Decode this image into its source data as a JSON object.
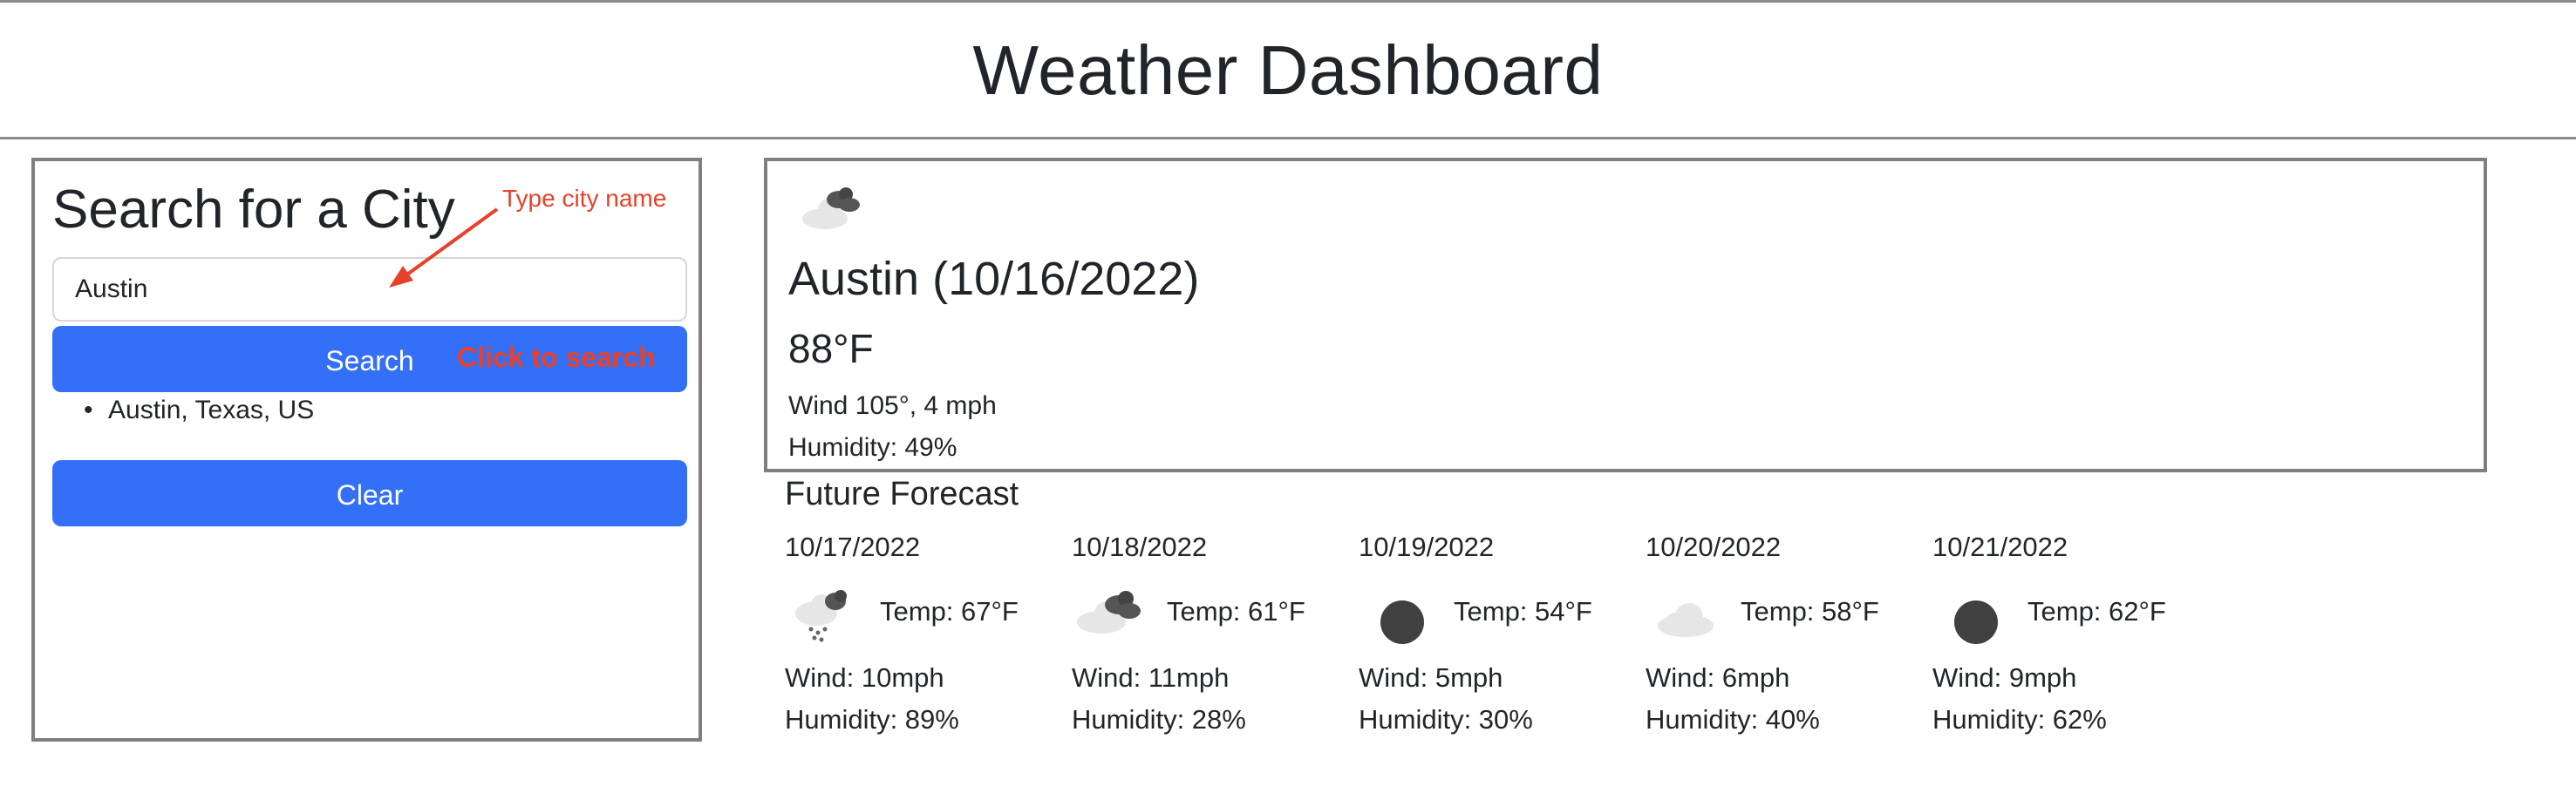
{
  "header": {
    "title": "Weather Dashboard"
  },
  "search": {
    "title": "Search for a City",
    "input_value": "Austin",
    "search_button_label": "Search",
    "clear_button_label": "Clear",
    "history": [
      "Austin, Texas, US"
    ],
    "accent_color": "#3370f7"
  },
  "annotations": {
    "type_hint": "Type city name",
    "click_hint": "Click to search",
    "color": "#e8412a"
  },
  "current": {
    "icon": "broken-clouds-icon",
    "city": "Austin (10/16/2022)",
    "temp": "88°F",
    "wind": "Wind 105°, 4 mph",
    "humidity": "Humidity: 49%"
  },
  "forecast": {
    "title": "Future Forecast",
    "days": [
      {
        "date": "10/17/2022",
        "icon": "rain-cloud-icon",
        "temp": "Temp: 67°F",
        "wind": "Wind: 10mph",
        "humidity": "Humidity: 89%"
      },
      {
        "date": "10/18/2022",
        "icon": "broken-clouds-icon",
        "temp": "Temp: 61°F",
        "wind": "Wind: 11mph",
        "humidity": "Humidity: 28%"
      },
      {
        "date": "10/19/2022",
        "icon": "overcast-circle-icon",
        "temp": "Temp: 54°F",
        "wind": "Wind: 5mph",
        "humidity": "Humidity: 30%"
      },
      {
        "date": "10/20/2022",
        "icon": "cloud-icon",
        "temp": "Temp: 58°F",
        "wind": "Wind: 6mph",
        "humidity": "Humidity: 40%"
      },
      {
        "date": "10/21/2022",
        "icon": "overcast-circle-icon",
        "temp": "Temp: 62°F",
        "wind": "Wind: 9mph",
        "humidity": "Humidity: 62%"
      }
    ]
  }
}
